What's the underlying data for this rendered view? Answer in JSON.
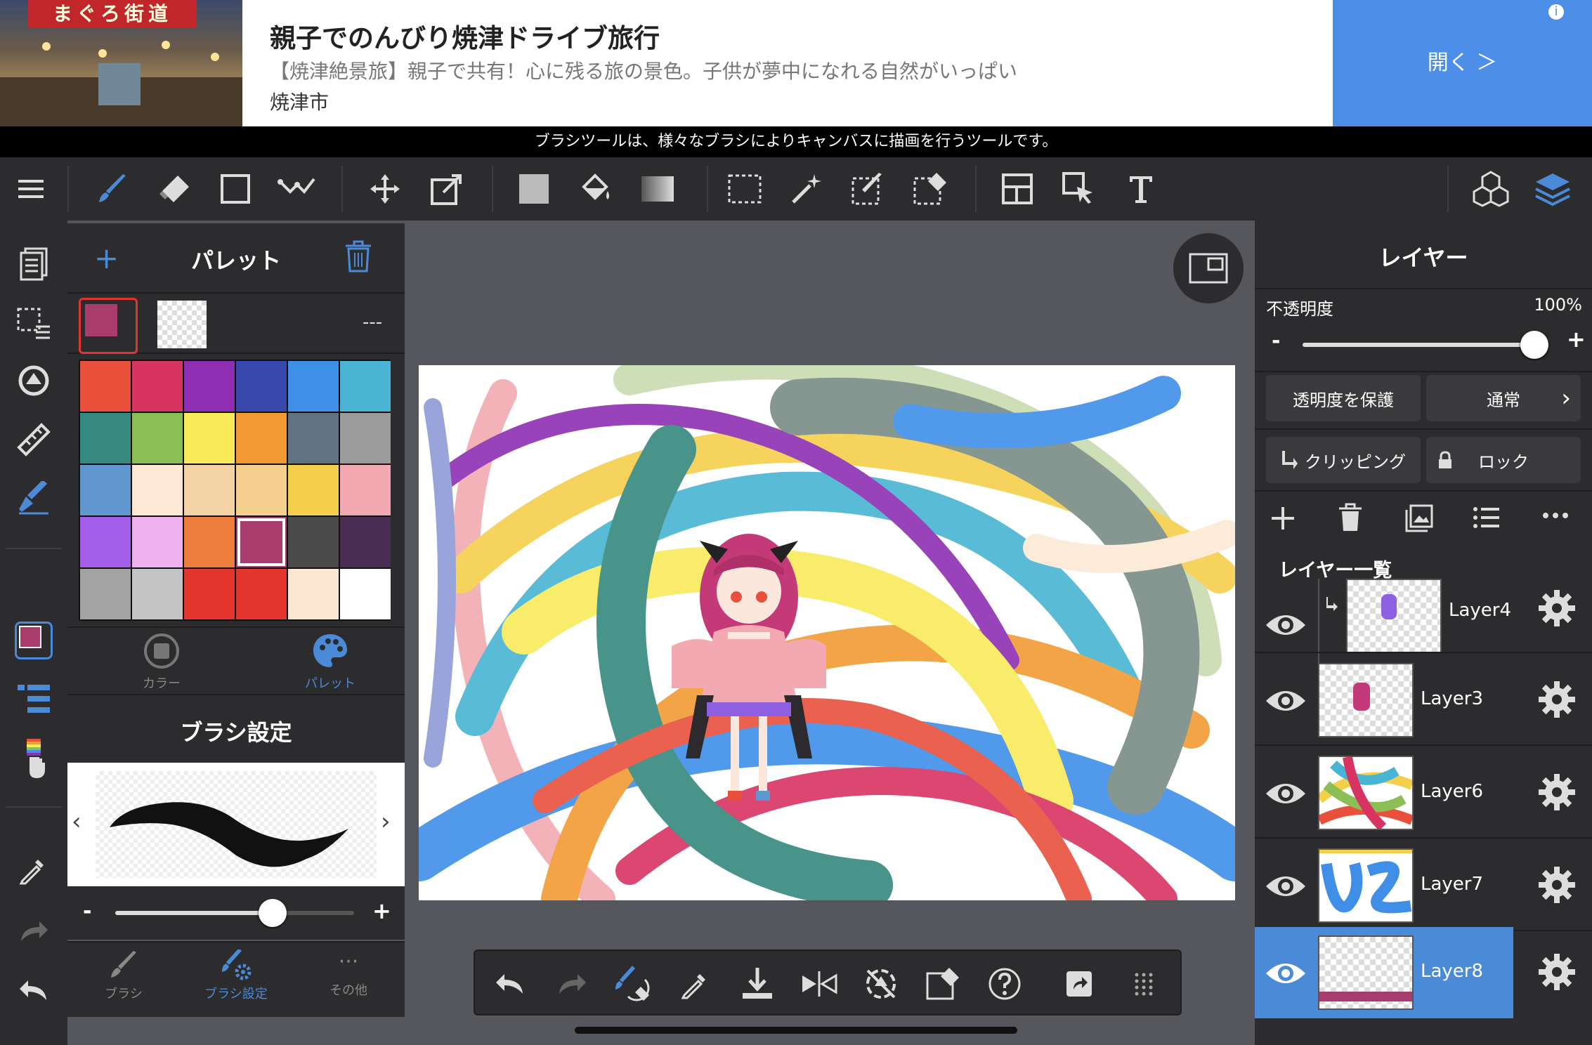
{
  "ad": {
    "title": "親子でのんびり焼津ドライブ旅行",
    "subtitle": "【焼津絶景旅】親子で共有！心に残る旅の景色。子供が夢中になれる自然がいっぱい",
    "location": "焼津市",
    "open_button": "開く ＞",
    "info": "i",
    "close": "✕",
    "photo_sign": "まぐろ街道"
  },
  "tip": "ブラシツールは、様々なブラシによりキャンバスに描画を行うツールです。",
  "palette": {
    "title": "パレット",
    "add": "+",
    "more": "---",
    "colors": [
      "#e8503c",
      "#d83462",
      "#8e2fb3",
      "#3a48ad",
      "#3f8ee8",
      "#49b4d3",
      "#35897e",
      "#8bbf55",
      "#f9ea5a",
      "#f29b33",
      "#5f7480",
      "#9b9b9b",
      "#6097cf",
      "#fde9d5",
      "#f3d2a6",
      "#f5cf8e",
      "#f4cf4c",
      "#f2a9b1",
      "#a35fe8",
      "#efb0ef",
      "#ee7f3e",
      "#a83c6d",
      "#4b4b4b",
      "#4a2d52",
      "#a3a3a3",
      "#c4c4c4",
      "#e3352b",
      "#e3352b",
      "#fde7d3",
      "#ffffff"
    ],
    "selected_index": 21,
    "current_color": "#a83c6d",
    "tabs": {
      "color": "カラー",
      "palette": "パレット"
    }
  },
  "brush": {
    "title": "ブラシ設定",
    "minus": "-",
    "plus": "+",
    "size_fraction": 0.8,
    "tabs": {
      "brush": "ブラシ",
      "brush_settings": "ブラシ設定",
      "other": "その他"
    },
    "other_icon": "···"
  },
  "layers": {
    "title": "レイヤー",
    "opacity_label": "不透明度",
    "opacity_value": "100%",
    "opacity_fraction": 1.0,
    "minus": "-",
    "plus": "+",
    "protect_alpha": "透明度を保護",
    "blend_mode": "通常",
    "clipping": "クリッピング",
    "lock": "ロック",
    "list_title": "レイヤー一覧",
    "items": [
      {
        "name": "Layer4",
        "clipped": true,
        "active": false
      },
      {
        "name": "Layer3",
        "clipped": false,
        "active": false
      },
      {
        "name": "Layer6",
        "clipped": false,
        "active": false
      },
      {
        "name": "Layer7",
        "clipped": false,
        "active": false
      },
      {
        "name": "Layer8",
        "clipped": false,
        "active": true
      }
    ]
  },
  "colors": {
    "accent": "#4a8ad6",
    "panel": "#2c2c2e",
    "workspace": "#55575c",
    "ad_button": "#4d8ee8"
  }
}
